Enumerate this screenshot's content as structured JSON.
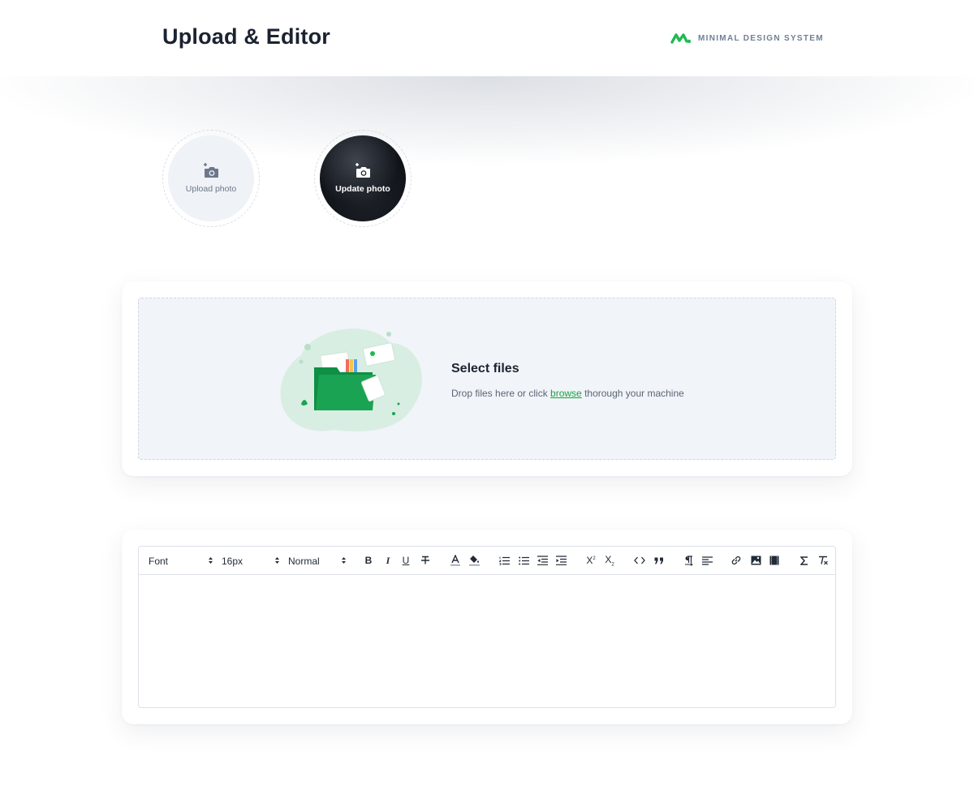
{
  "header": {
    "title": "Upload & Editor",
    "brand_name": "MINIMAL DESIGN SYSTEM",
    "brand_color": "#1fb954"
  },
  "avatars": {
    "upload_label": "Upload photo",
    "update_label": "Update photo",
    "icon": "camera-plus-icon"
  },
  "dropzone": {
    "title": "Select files",
    "text_before": "Drop files here or click ",
    "link_text": "browse",
    "text_after": " thorough your machine",
    "accent": "#14a33e"
  },
  "editor": {
    "font_select": "Font",
    "size_select": "16px",
    "style_select": "Normal",
    "content": "",
    "tools": [
      "bold",
      "italic",
      "underline",
      "strikethrough",
      "text-color",
      "highlight",
      "ordered-list",
      "bullet-list",
      "outdent",
      "indent",
      "superscript",
      "subscript",
      "code",
      "quote",
      "text-direction",
      "align-left",
      "link",
      "image",
      "video",
      "formula",
      "clear-formatting"
    ],
    "bold_label": "B",
    "italic_label": "I",
    "underline_label": "U",
    "superscript_label": "X",
    "subscript_label": "X"
  }
}
